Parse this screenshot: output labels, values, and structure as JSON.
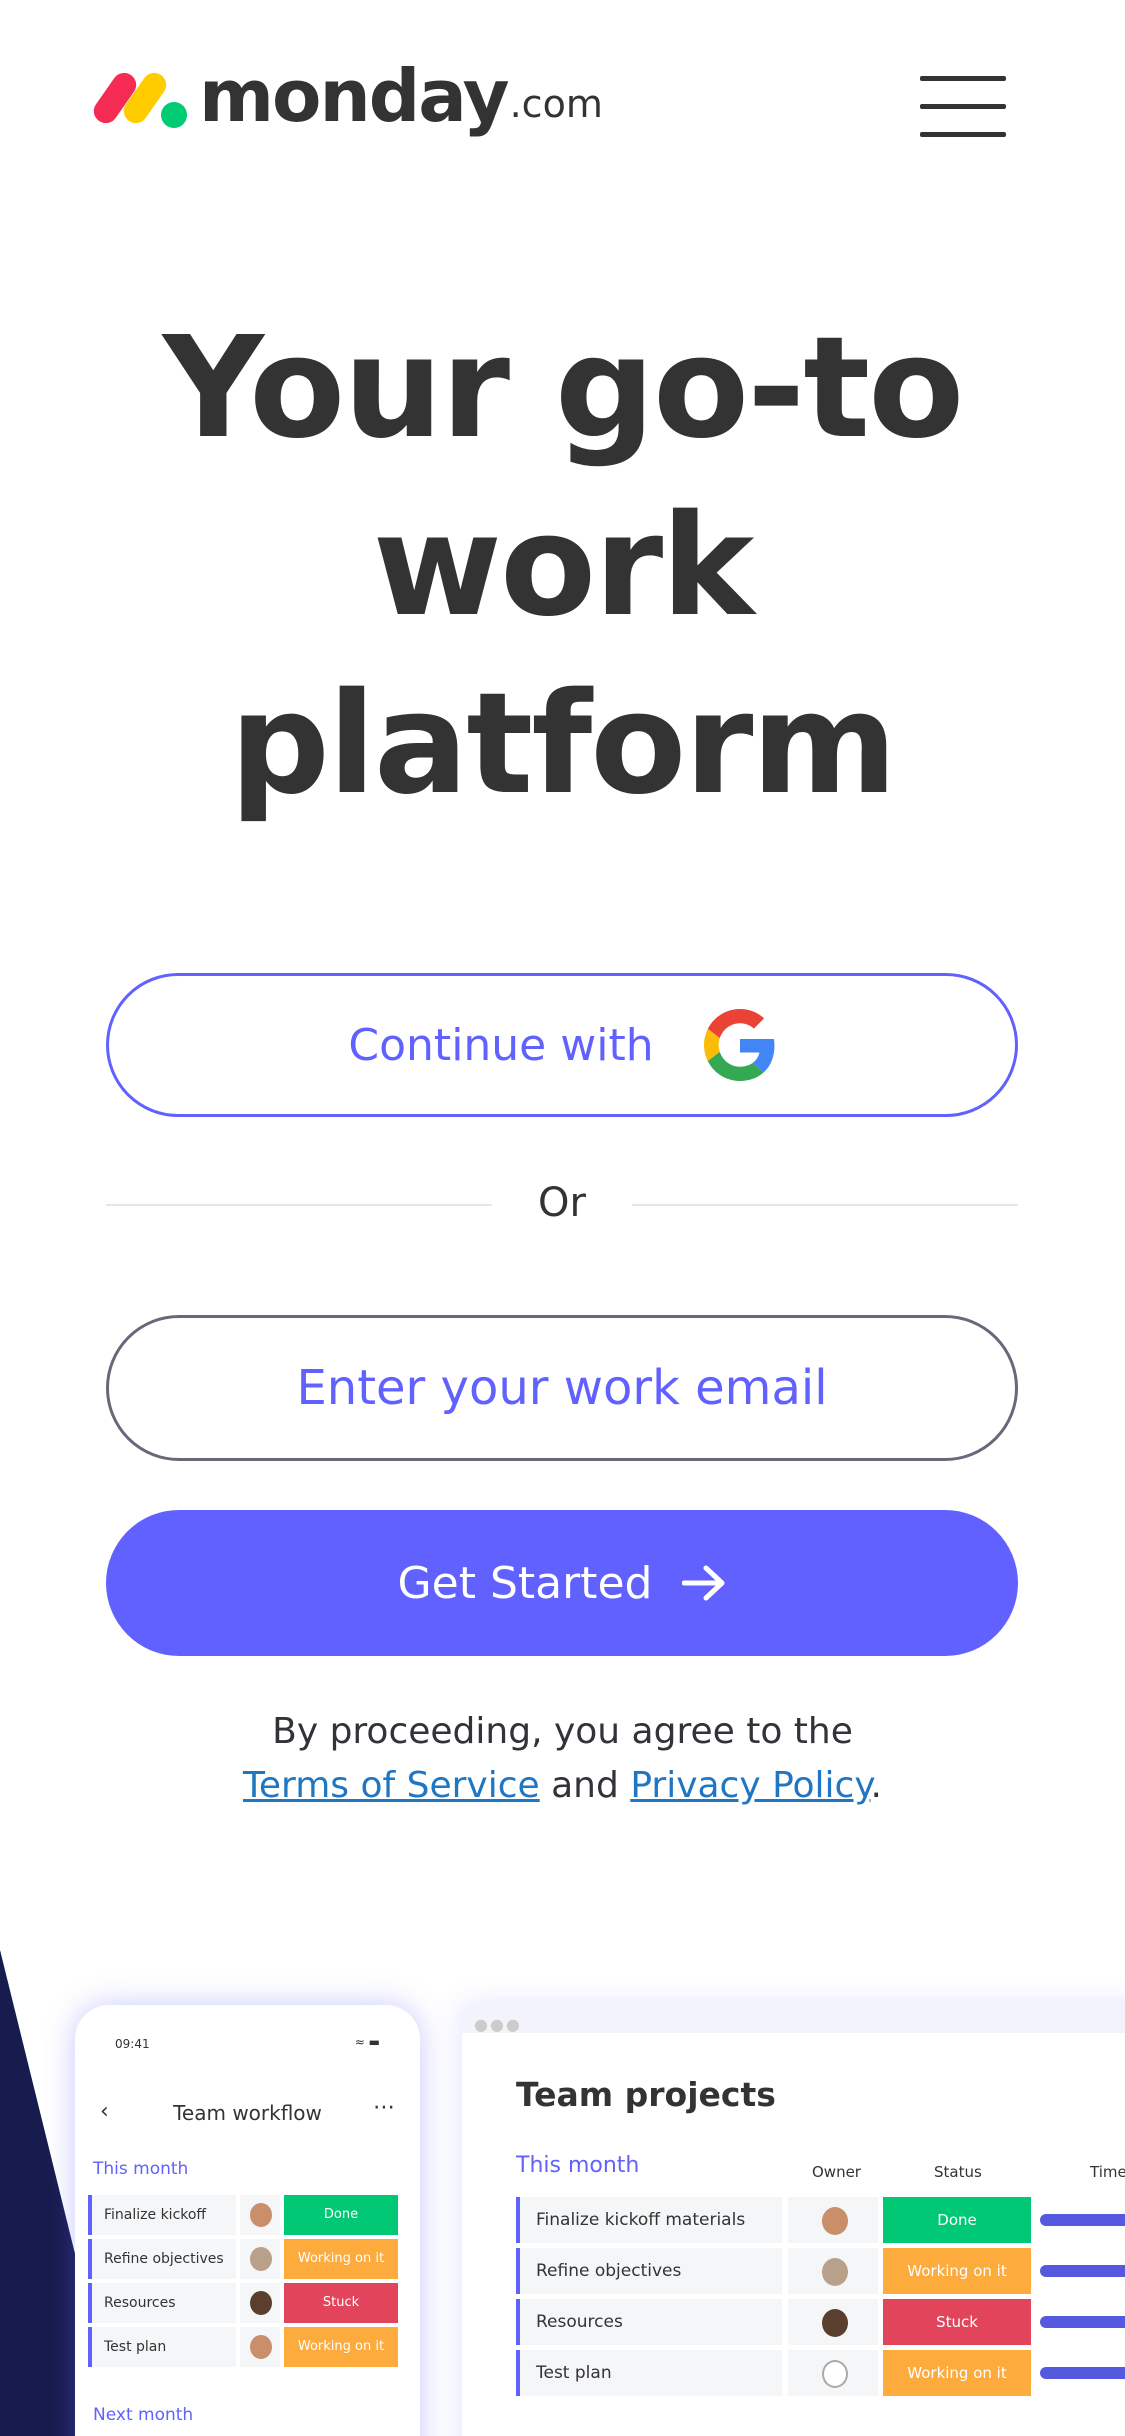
{
  "header": {
    "logo_word": "monday",
    "logo_suffix": ".com",
    "menu_icon": "hamburger-menu-icon"
  },
  "hero": {
    "line1": "Your go-to",
    "line2": "work",
    "line3": "platform"
  },
  "google_button": {
    "label": "Continue with",
    "icon": "google-icon"
  },
  "divider": {
    "text": "Or"
  },
  "email": {
    "placeholder": "Enter your work email",
    "value": ""
  },
  "cta": {
    "label": "Get Started",
    "icon": "arrow-right-icon"
  },
  "legal": {
    "prefix": "By proceeding, you agree to the",
    "terms": "Terms of Service",
    "and": "and",
    "privacy": "Privacy Policy",
    "suffix": "."
  },
  "colors": {
    "accent": "#6161ff",
    "done": "#00c875",
    "working": "#fdab3d",
    "stuck": "#e2445c",
    "navy": "#181b4d"
  },
  "phone_preview": {
    "time": "09:41",
    "title": "Team workflow",
    "group": "This month",
    "next_group": "Next month",
    "rows": [
      {
        "name": "Finalize kickoff",
        "status": "Done"
      },
      {
        "name": "Refine objectives",
        "status": "Working on it"
      },
      {
        "name": "Resources",
        "status": "Stuck"
      },
      {
        "name": "Test plan",
        "status": "Working on it"
      }
    ]
  },
  "desktop_preview": {
    "title": "Team projects",
    "group": "This month",
    "columns": [
      "Owner",
      "Status",
      "Time"
    ],
    "rows": [
      {
        "name": "Finalize kickoff materials",
        "status": "Done"
      },
      {
        "name": "Refine objectives",
        "status": "Working on it"
      },
      {
        "name": "Resources",
        "status": "Stuck"
      },
      {
        "name": "Test plan",
        "status": "Working on it"
      }
    ]
  }
}
